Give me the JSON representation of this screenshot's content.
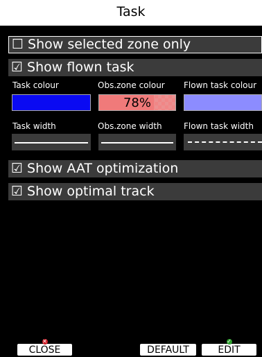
{
  "window": {
    "title": "Task"
  },
  "options": [
    {
      "checkbox": "☐",
      "label": "Show selected zone only"
    },
    {
      "checkbox": "☑",
      "label": "Show flown task"
    },
    {
      "checkbox": "☑",
      "label": "Show AAT optimization"
    },
    {
      "checkbox": "☑",
      "label": "Show optimal track"
    }
  ],
  "colours": {
    "task_label": "Task colour",
    "obs_label": "Obs.zone colour",
    "flown_label": "Flown task colour",
    "task_color": "#0a0af2",
    "obs_color": "#f07a7a",
    "obs_opacity": "78%",
    "flown_color": "#8c8cff"
  },
  "widths": {
    "task_label": "Task width",
    "obs_label": "Obs.zone width",
    "flown_label": "Flown task width",
    "task_style": "solid",
    "obs_style": "solid",
    "flown_style": "dashed"
  },
  "buttons": {
    "close": "CLOSE",
    "default": "DEFAULT",
    "edit": "EDIT",
    "close_mark_color": "#d0202a",
    "edit_mark_color": "#2ea12e"
  }
}
